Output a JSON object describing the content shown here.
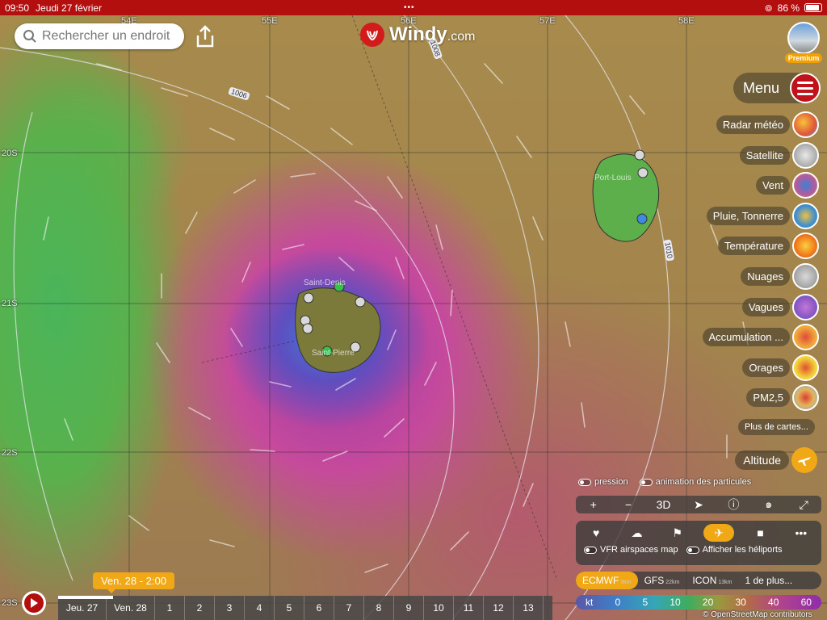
{
  "status": {
    "time": "09:50",
    "date": "Jeudi 27 février",
    "battery": "86 %"
  },
  "search": {
    "placeholder": "Rechercher un endroit"
  },
  "logo": {
    "name": "Windy",
    "domain": ".com"
  },
  "account": {
    "badge": "Premium"
  },
  "menu": {
    "label": "Menu"
  },
  "layers": [
    {
      "label": "Radar météo",
      "icon": "radar-icon",
      "color": "#e0573a"
    },
    {
      "label": "Satellite",
      "icon": "satellite-icon",
      "color": "#bdbdbd"
    },
    {
      "label": "Vent",
      "icon": "wind-icon",
      "color": "#b75a9b",
      "active": true
    },
    {
      "label": "Pluie, Tonnerre",
      "icon": "rain-icon",
      "color": "#3f8fd0"
    },
    {
      "label": "Température",
      "icon": "temperature-icon",
      "color": "#f07a1c"
    },
    {
      "label": "Nuages",
      "icon": "clouds-icon",
      "color": "#a9a9a9"
    },
    {
      "label": "Vagues",
      "icon": "waves-icon",
      "color": "#8b56c4"
    },
    {
      "label": "Accumulation ...",
      "icon": "accumulation-icon",
      "color": "#f0a83a"
    },
    {
      "label": "Orages",
      "icon": "storms-icon",
      "color": "#f3d23a"
    },
    {
      "label": "PM2,5",
      "icon": "pm25-icon",
      "color": "#e6b35c"
    }
  ],
  "more_maps": "Plus de cartes...",
  "altitude": "Altitude",
  "toggles": {
    "pressure": "pression",
    "particles": "animation des particules"
  },
  "controls": {
    "zoom_in": "+",
    "zoom_out": "−",
    "three_d": "3D"
  },
  "tools": {
    "vfr": "VFR airspaces map",
    "heliports": "Afficher les héliports"
  },
  "models": [
    {
      "name": "ECMWF",
      "res": "9km",
      "active": true
    },
    {
      "name": "GFS",
      "res": "22km"
    },
    {
      "name": "ICON",
      "res": "13km"
    },
    {
      "name": "1 de plus...",
      "res": ""
    }
  ],
  "legend": {
    "unit": "kt",
    "values": [
      "0",
      "5",
      "10",
      "20",
      "30",
      "40",
      "60"
    ]
  },
  "attribution": "© OpenStreetMap contributors",
  "timeline": {
    "current": "Ven. 28 - 2:00",
    "days": [
      "Jeu. 27",
      "Ven. 28",
      "1",
      "2",
      "3",
      "4",
      "5",
      "6",
      "7",
      "8",
      "9",
      "10",
      "11",
      "12",
      "13"
    ]
  },
  "grid": {
    "lon": [
      "54E",
      "55E",
      "56E",
      "57E",
      "58E"
    ],
    "lat": [
      "20S",
      "21S",
      "22S",
      "23S"
    ]
  },
  "isobars": [
    "1006",
    "1008",
    "1010"
  ],
  "cities": [
    "Port-Louis",
    "Saint-Denis",
    "Saint-Pierre"
  ],
  "colors": {
    "accent": "#f0a816",
    "brand": "#c0121a",
    "statusbar": "#b40f0f"
  }
}
